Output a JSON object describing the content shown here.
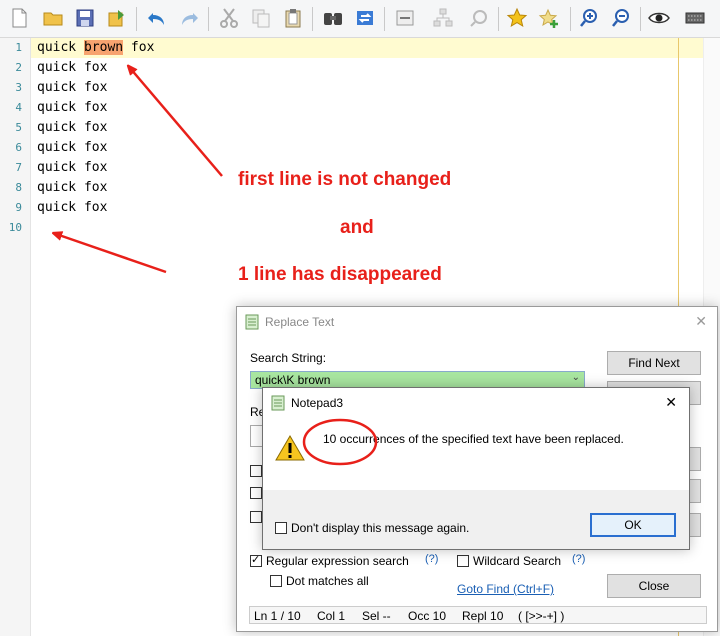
{
  "editor": {
    "lines": [
      {
        "num": "1",
        "before": "quick ",
        "highlight": "brown",
        "after": " fox"
      },
      {
        "num": "2",
        "text": "quick fox"
      },
      {
        "num": "3",
        "text": "quick fox"
      },
      {
        "num": "4",
        "text": "quick fox"
      },
      {
        "num": "5",
        "text": "quick fox"
      },
      {
        "num": "6",
        "text": "quick fox"
      },
      {
        "num": "7",
        "text": "quick fox"
      },
      {
        "num": "8",
        "text": "quick fox"
      },
      {
        "num": "9",
        "text": "quick fox"
      },
      {
        "num": "10",
        "text": ""
      }
    ]
  },
  "annotations": {
    "line1": "first line is not changed",
    "line2": "and",
    "line3": "1 line   has disappeared",
    "color": "#e8201a"
  },
  "replace_dialog": {
    "title": "Replace Text",
    "search_label": "Search String:",
    "search_value": "quick\\K brown",
    "find_next": "Find Next",
    "replace_label_partial": "Re",
    "regex_label": "Regular expression search",
    "regex_checked": true,
    "dot_matches": "Dot matches all",
    "wildcard": "Wildcard Search",
    "help": "(?)",
    "goto_find": "Goto Find (Ctrl+F)",
    "close": "Close",
    "status": {
      "ln": "Ln 1 / 10",
      "col": "Col 1",
      "sel": "Sel --",
      "occ": "Occ 10",
      "repl": "Repl 10",
      "nav": "( [>>-+] )"
    }
  },
  "message_box": {
    "title": "Notepad3",
    "message": "10 occurrences of the specified text have been replaced.",
    "dont_show": "Don't display this message again.",
    "ok": "OK",
    "close_glyph": "✕"
  },
  "toolbar": {
    "icons": [
      "new-file-icon",
      "open-folder-icon",
      "save-icon",
      "save-as-icon",
      "undo-icon",
      "redo-icon",
      "cut-icon",
      "copy-icon",
      "paste-icon",
      "find-icon",
      "replace-icon",
      "word-wrap-icon",
      "goto-icon",
      "zoom-find-icon",
      "favorite-icon",
      "add-favorite-icon",
      "zoom-in-icon",
      "zoom-out-icon",
      "view-icon",
      "settings-icon"
    ]
  }
}
